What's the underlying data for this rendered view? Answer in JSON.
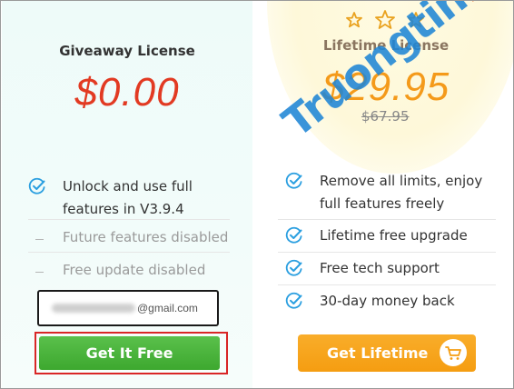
{
  "giveaway": {
    "title": "Giveaway License",
    "price": "$0.00",
    "features": [
      {
        "text": "Unlock and use full features in V3.9.4",
        "state": "included",
        "icon": "check-circle-icon"
      },
      {
        "text": "Future features disabled",
        "state": "excluded",
        "icon": "dash-icon"
      },
      {
        "text": "Free update disabled",
        "state": "excluded",
        "icon": "dash-icon"
      }
    ],
    "email_domain": "@gmail.com",
    "button_label": "Get It Free",
    "button_color": "#4cb63e",
    "highlight_color": "#d92626"
  },
  "lifetime": {
    "title": "Lifetime License",
    "price": "$29.95",
    "old_price": "$67.95",
    "stars": 3,
    "features": [
      {
        "text": "Remove all limits, enjoy full features freely",
        "state": "included",
        "icon": "check-circle-icon"
      },
      {
        "text": "Lifetime free upgrade",
        "state": "included",
        "icon": "check-circle-icon"
      },
      {
        "text": "Free tech support",
        "state": "included",
        "icon": "check-circle-icon"
      },
      {
        "text": "30-day money back",
        "state": "included",
        "icon": "check-circle-icon"
      }
    ],
    "button_label": "Get Lifetime",
    "button_icon": "shopping-cart-icon",
    "button_color": "#f7a51d"
  },
  "watermark": {
    "part1": "Truongtin",
    "part2": ".top"
  },
  "colors": {
    "check": "#2b9fe0",
    "free_price": "#e23a22",
    "lifetime_price": "#f49a1a"
  }
}
